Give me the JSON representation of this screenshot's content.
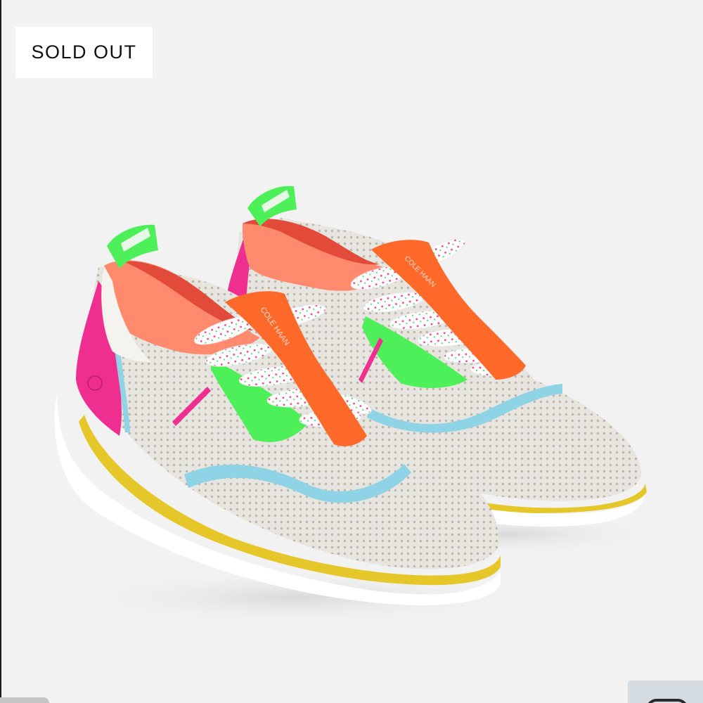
{
  "badge": {
    "label": "SOLD OUT"
  },
  "product": {
    "brand_on_strap": "COLE HAAN"
  },
  "colors": {
    "background": "#f2f2f2",
    "upper_mesh": "#e6e4de",
    "pull_strap": "#ff6a2b",
    "heel_pink": "#ef2f8f",
    "accent_green": "#4ef05a",
    "wave_blue": "#8fd3e6",
    "sole_yellow": "#e6c72a",
    "lining_coral": "#ff8a6e"
  },
  "icons": {
    "gallery": "gallery-toggle-icon"
  }
}
